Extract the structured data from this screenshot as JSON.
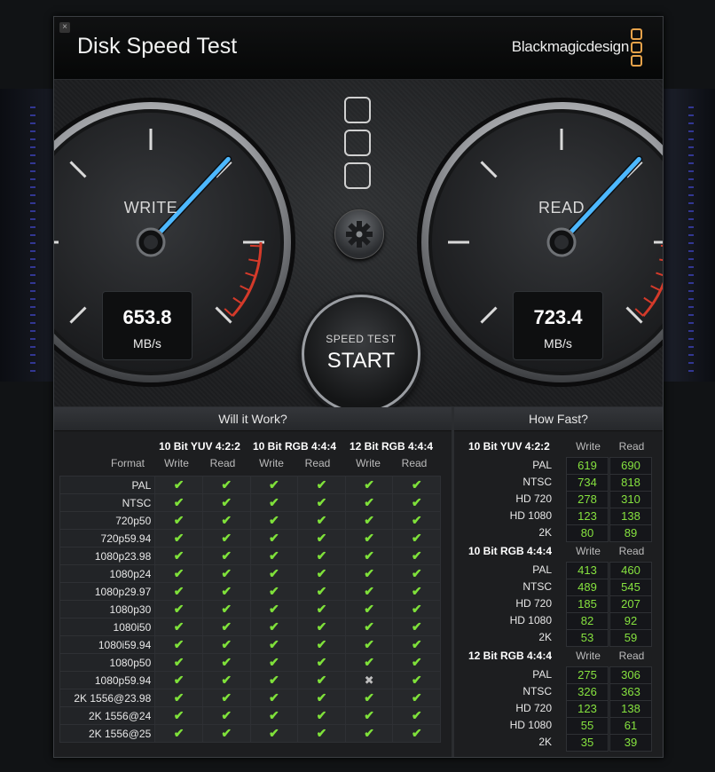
{
  "app": {
    "title": "Disk Speed Test",
    "brand": "Blackmagicdesign",
    "close_icon": "×",
    "accent": "#e6a24a"
  },
  "write_gauge": {
    "label": "WRITE",
    "value": "653.8",
    "unit": "MB/s",
    "needle_angle_deg": 133
  },
  "read_gauge": {
    "label": "READ",
    "value": "723.4",
    "unit": "MB/s",
    "needle_angle_deg": 133
  },
  "controls": {
    "config_icon": "preset-config-icon",
    "gear_icon": "gear-icon",
    "start_top": "SPEED TEST",
    "start_main": "START"
  },
  "will_it_work": {
    "heading": "Will it Work?",
    "format_label": "Format",
    "groups": [
      {
        "title": "10 Bit YUV 4:2:2",
        "write": "Write",
        "read": "Read"
      },
      {
        "title": "10 Bit RGB 4:4:4",
        "write": "Write",
        "read": "Read"
      },
      {
        "title": "12 Bit RGB 4:4:4",
        "write": "Write",
        "read": "Read"
      }
    ],
    "check_glyph": "✔",
    "cross_glyph": "✖",
    "rows": [
      {
        "name": "PAL",
        "cells": [
          1,
          1,
          1,
          1,
          1,
          1
        ]
      },
      {
        "name": "NTSC",
        "cells": [
          1,
          1,
          1,
          1,
          1,
          1
        ]
      },
      {
        "name": "720p50",
        "cells": [
          1,
          1,
          1,
          1,
          1,
          1
        ]
      },
      {
        "name": "720p59.94",
        "cells": [
          1,
          1,
          1,
          1,
          1,
          1
        ]
      },
      {
        "name": "1080p23.98",
        "cells": [
          1,
          1,
          1,
          1,
          1,
          1
        ]
      },
      {
        "name": "1080p24",
        "cells": [
          1,
          1,
          1,
          1,
          1,
          1
        ]
      },
      {
        "name": "1080p29.97",
        "cells": [
          1,
          1,
          1,
          1,
          1,
          1
        ]
      },
      {
        "name": "1080p30",
        "cells": [
          1,
          1,
          1,
          1,
          1,
          1
        ]
      },
      {
        "name": "1080i50",
        "cells": [
          1,
          1,
          1,
          1,
          1,
          1
        ]
      },
      {
        "name": "1080i59.94",
        "cells": [
          1,
          1,
          1,
          1,
          1,
          1
        ]
      },
      {
        "name": "1080p50",
        "cells": [
          1,
          1,
          1,
          1,
          1,
          1
        ]
      },
      {
        "name": "1080p59.94",
        "cells": [
          1,
          1,
          1,
          1,
          0,
          1
        ]
      },
      {
        "name": "2K 1556@23.98",
        "cells": [
          1,
          1,
          1,
          1,
          1,
          1
        ]
      },
      {
        "name": "2K 1556@24",
        "cells": [
          1,
          1,
          1,
          1,
          1,
          1
        ]
      },
      {
        "name": "2K 1556@25",
        "cells": [
          1,
          1,
          1,
          1,
          1,
          1
        ]
      }
    ]
  },
  "how_fast": {
    "heading": "How Fast?",
    "groups": [
      {
        "title": "10 Bit YUV 4:2:2",
        "write": "Write",
        "read": "Read",
        "rows": [
          {
            "name": "PAL",
            "w": "619",
            "r": "690"
          },
          {
            "name": "NTSC",
            "w": "734",
            "r": "818"
          },
          {
            "name": "HD 720",
            "w": "278",
            "r": "310"
          },
          {
            "name": "HD 1080",
            "w": "123",
            "r": "138"
          },
          {
            "name": "2K",
            "w": "80",
            "r": "89"
          }
        ]
      },
      {
        "title": "10 Bit RGB 4:4:4",
        "write": "Write",
        "read": "Read",
        "rows": [
          {
            "name": "PAL",
            "w": "413",
            "r": "460"
          },
          {
            "name": "NTSC",
            "w": "489",
            "r": "545"
          },
          {
            "name": "HD 720",
            "w": "185",
            "r": "207"
          },
          {
            "name": "HD 1080",
            "w": "82",
            "r": "92"
          },
          {
            "name": "2K",
            "w": "53",
            "r": "59"
          }
        ]
      },
      {
        "title": "12 Bit RGB 4:4:4",
        "write": "Write",
        "read": "Read",
        "rows": [
          {
            "name": "PAL",
            "w": "275",
            "r": "306"
          },
          {
            "name": "NTSC",
            "w": "326",
            "r": "363"
          },
          {
            "name": "HD 720",
            "w": "123",
            "r": "138"
          },
          {
            "name": "HD 1080",
            "w": "55",
            "r": "61"
          },
          {
            "name": "2K",
            "w": "35",
            "r": "39"
          }
        ]
      }
    ]
  }
}
